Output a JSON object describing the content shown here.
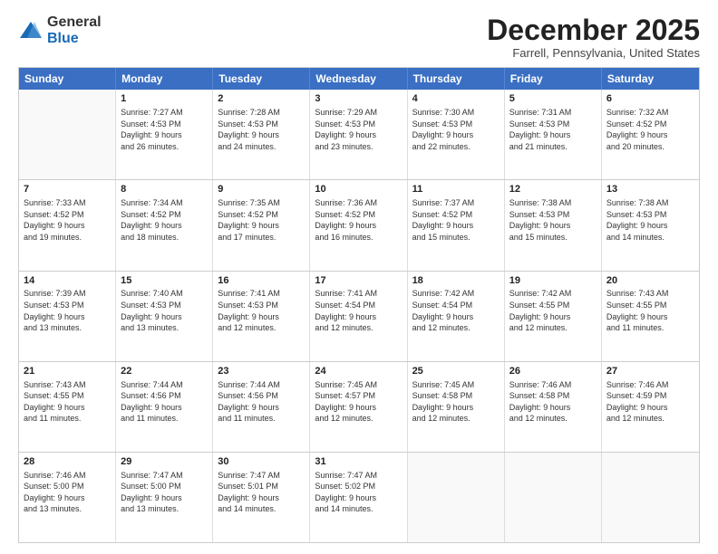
{
  "logo": {
    "general": "General",
    "blue": "Blue"
  },
  "header": {
    "month": "December 2025",
    "location": "Farrell, Pennsylvania, United States"
  },
  "days": [
    "Sunday",
    "Monday",
    "Tuesday",
    "Wednesday",
    "Thursday",
    "Friday",
    "Saturday"
  ],
  "weeks": [
    [
      {
        "day": "",
        "info": ""
      },
      {
        "day": "1",
        "info": "Sunrise: 7:27 AM\nSunset: 4:53 PM\nDaylight: 9 hours\nand 26 minutes."
      },
      {
        "day": "2",
        "info": "Sunrise: 7:28 AM\nSunset: 4:53 PM\nDaylight: 9 hours\nand 24 minutes."
      },
      {
        "day": "3",
        "info": "Sunrise: 7:29 AM\nSunset: 4:53 PM\nDaylight: 9 hours\nand 23 minutes."
      },
      {
        "day": "4",
        "info": "Sunrise: 7:30 AM\nSunset: 4:53 PM\nDaylight: 9 hours\nand 22 minutes."
      },
      {
        "day": "5",
        "info": "Sunrise: 7:31 AM\nSunset: 4:53 PM\nDaylight: 9 hours\nand 21 minutes."
      },
      {
        "day": "6",
        "info": "Sunrise: 7:32 AM\nSunset: 4:52 PM\nDaylight: 9 hours\nand 20 minutes."
      }
    ],
    [
      {
        "day": "7",
        "info": "Sunrise: 7:33 AM\nSunset: 4:52 PM\nDaylight: 9 hours\nand 19 minutes."
      },
      {
        "day": "8",
        "info": "Sunrise: 7:34 AM\nSunset: 4:52 PM\nDaylight: 9 hours\nand 18 minutes."
      },
      {
        "day": "9",
        "info": "Sunrise: 7:35 AM\nSunset: 4:52 PM\nDaylight: 9 hours\nand 17 minutes."
      },
      {
        "day": "10",
        "info": "Sunrise: 7:36 AM\nSunset: 4:52 PM\nDaylight: 9 hours\nand 16 minutes."
      },
      {
        "day": "11",
        "info": "Sunrise: 7:37 AM\nSunset: 4:52 PM\nDaylight: 9 hours\nand 15 minutes."
      },
      {
        "day": "12",
        "info": "Sunrise: 7:38 AM\nSunset: 4:53 PM\nDaylight: 9 hours\nand 15 minutes."
      },
      {
        "day": "13",
        "info": "Sunrise: 7:38 AM\nSunset: 4:53 PM\nDaylight: 9 hours\nand 14 minutes."
      }
    ],
    [
      {
        "day": "14",
        "info": "Sunrise: 7:39 AM\nSunset: 4:53 PM\nDaylight: 9 hours\nand 13 minutes."
      },
      {
        "day": "15",
        "info": "Sunrise: 7:40 AM\nSunset: 4:53 PM\nDaylight: 9 hours\nand 13 minutes."
      },
      {
        "day": "16",
        "info": "Sunrise: 7:41 AM\nSunset: 4:53 PM\nDaylight: 9 hours\nand 12 minutes."
      },
      {
        "day": "17",
        "info": "Sunrise: 7:41 AM\nSunset: 4:54 PM\nDaylight: 9 hours\nand 12 minutes."
      },
      {
        "day": "18",
        "info": "Sunrise: 7:42 AM\nSunset: 4:54 PM\nDaylight: 9 hours\nand 12 minutes."
      },
      {
        "day": "19",
        "info": "Sunrise: 7:42 AM\nSunset: 4:55 PM\nDaylight: 9 hours\nand 12 minutes."
      },
      {
        "day": "20",
        "info": "Sunrise: 7:43 AM\nSunset: 4:55 PM\nDaylight: 9 hours\nand 11 minutes."
      }
    ],
    [
      {
        "day": "21",
        "info": "Sunrise: 7:43 AM\nSunset: 4:55 PM\nDaylight: 9 hours\nand 11 minutes."
      },
      {
        "day": "22",
        "info": "Sunrise: 7:44 AM\nSunset: 4:56 PM\nDaylight: 9 hours\nand 11 minutes."
      },
      {
        "day": "23",
        "info": "Sunrise: 7:44 AM\nSunset: 4:56 PM\nDaylight: 9 hours\nand 11 minutes."
      },
      {
        "day": "24",
        "info": "Sunrise: 7:45 AM\nSunset: 4:57 PM\nDaylight: 9 hours\nand 12 minutes."
      },
      {
        "day": "25",
        "info": "Sunrise: 7:45 AM\nSunset: 4:58 PM\nDaylight: 9 hours\nand 12 minutes."
      },
      {
        "day": "26",
        "info": "Sunrise: 7:46 AM\nSunset: 4:58 PM\nDaylight: 9 hours\nand 12 minutes."
      },
      {
        "day": "27",
        "info": "Sunrise: 7:46 AM\nSunset: 4:59 PM\nDaylight: 9 hours\nand 12 minutes."
      }
    ],
    [
      {
        "day": "28",
        "info": "Sunrise: 7:46 AM\nSunset: 5:00 PM\nDaylight: 9 hours\nand 13 minutes."
      },
      {
        "day": "29",
        "info": "Sunrise: 7:47 AM\nSunset: 5:00 PM\nDaylight: 9 hours\nand 13 minutes."
      },
      {
        "day": "30",
        "info": "Sunrise: 7:47 AM\nSunset: 5:01 PM\nDaylight: 9 hours\nand 14 minutes."
      },
      {
        "day": "31",
        "info": "Sunrise: 7:47 AM\nSunset: 5:02 PM\nDaylight: 9 hours\nand 14 minutes."
      },
      {
        "day": "",
        "info": ""
      },
      {
        "day": "",
        "info": ""
      },
      {
        "day": "",
        "info": ""
      }
    ]
  ]
}
